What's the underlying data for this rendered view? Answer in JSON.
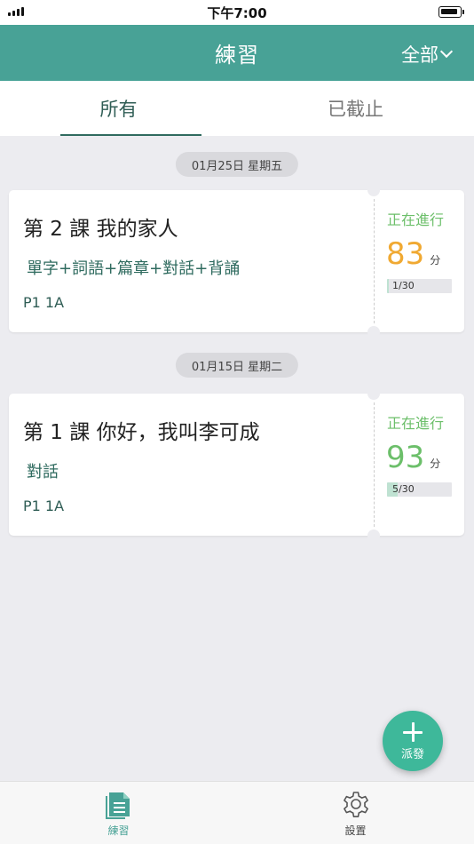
{
  "status_bar": {
    "time": "下午7:00"
  },
  "nav": {
    "title": "練習",
    "filter_label": "全部"
  },
  "tabs": [
    {
      "label": "所有",
      "active": true
    },
    {
      "label": "已截止",
      "active": false
    }
  ],
  "groups": [
    {
      "date": "01月25日 星期五",
      "card": {
        "title": "第 2 課 我的家人",
        "skills": "單字+詞語+篇章+對話+背誦",
        "class": "P1 1A",
        "status": "正在進行",
        "score": "83",
        "score_unit": "分",
        "score_color": "#f0a932",
        "progress_label": "1/30",
        "progress_fraction": 0.033
      }
    },
    {
      "date": "01月15日 星期二",
      "card": {
        "title": "第 1 課 你好，我叫李可成",
        "skills": "對話",
        "class": "P1 1A",
        "status": "正在進行",
        "score": "93",
        "score_unit": "分",
        "score_color": "#6cbf6a",
        "progress_label": "5/30",
        "progress_fraction": 0.167
      }
    }
  ],
  "fab": {
    "label": "派發"
  },
  "tab_bar": [
    {
      "label": "練習",
      "icon": "document-icon",
      "active": true
    },
    {
      "label": "設置",
      "icon": "gear-icon",
      "active": false
    }
  ],
  "colors": {
    "header": "#48a296",
    "accent": "#3eb89a",
    "status": "#6cbf6a"
  }
}
